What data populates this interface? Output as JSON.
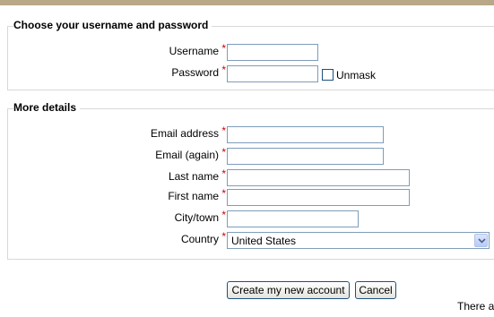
{
  "section1": {
    "legend": "Choose your username and password",
    "fields": [
      {
        "label": "Username",
        "required": true,
        "value": ""
      },
      {
        "label": "Password",
        "required": true,
        "value": ""
      }
    ],
    "unmask_label": "Unmask"
  },
  "section2": {
    "legend": "More details",
    "fields": [
      {
        "label": "Email address",
        "required": true,
        "value": ""
      },
      {
        "label": "Email (again)",
        "required": true,
        "value": ""
      },
      {
        "label": "Last name",
        "required": true,
        "value": ""
      },
      {
        "label": "First name",
        "required": true,
        "value": ""
      },
      {
        "label": "City/town",
        "required": true,
        "value": ""
      },
      {
        "label": "Country",
        "required": true,
        "value": "United States"
      }
    ]
  },
  "required_mark": "*",
  "buttons": {
    "create": "Create my new account",
    "cancel": "Cancel"
  },
  "trailing_text": "There a"
}
